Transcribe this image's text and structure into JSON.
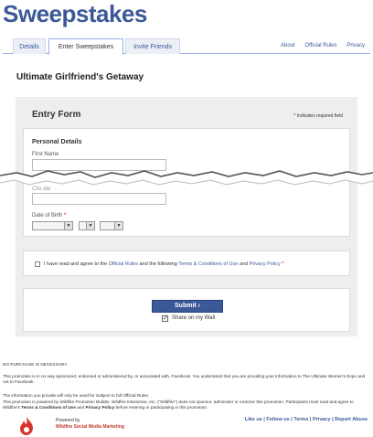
{
  "app": {
    "title": "Sweepstakes"
  },
  "tabs": [
    {
      "label": "Details"
    },
    {
      "label": "Enter Sweepstakes"
    },
    {
      "label": "Invite Friends"
    }
  ],
  "top_links": [
    "About",
    "Official Rules",
    "Privacy"
  ],
  "promo": {
    "title": "Ultimate Girlfriend's Getaway"
  },
  "form": {
    "title": "Entry Form",
    "required_note": "* Indicates required field",
    "section": "Personal Details",
    "first_name_label": "First Name",
    "partial_label": "Citv   ate",
    "dob_label": "Date of Birth",
    "required_star": "*",
    "agree": {
      "prefix": "I have read and agree to the",
      "rules_link": "Official Rules",
      "middle": "and the following",
      "terms_link": "Terms & Conditions of Use",
      "and": "and",
      "privacy_link": "Privacy Policy",
      "star": "*"
    },
    "submit_label": "Submit ›",
    "share_label": "Share on my Wall"
  },
  "legal": {
    "no_purchase": "NO PURCHASE IS NECESSARY.",
    "p1": "This promotion is in no way sponsored, endorsed or administered by, or associated with, Facebook. You understand that you are providing your information to The Ultimate Women's Expo and not to Facebook.",
    "p2": "The information you provide will only be used for Subject to full Official Rules.",
    "p3a": "This promotion is powered by Wildfire Promotion Builder. Wildfire Interactive, Inc. (\"Wildfire\") does not sponsor, administer or endorse this promotion. Participants must read and agree to Wildfire's",
    "p3_terms": "Terms & Conditions of Use",
    "p3_and": "and",
    "p3_privacy": "Privacy Policy",
    "p3b": "before entering or participating in this promotion."
  },
  "footer": {
    "powered_by": "Powered by",
    "brand": "Wildfire Social Media Marketing",
    "links": "Like us | Follow us | Terms | Privacy | Report Abuse"
  },
  "colors": {
    "brand": "#3b5998",
    "required": "#cc0000",
    "panel_bg": "#eeeeee"
  }
}
